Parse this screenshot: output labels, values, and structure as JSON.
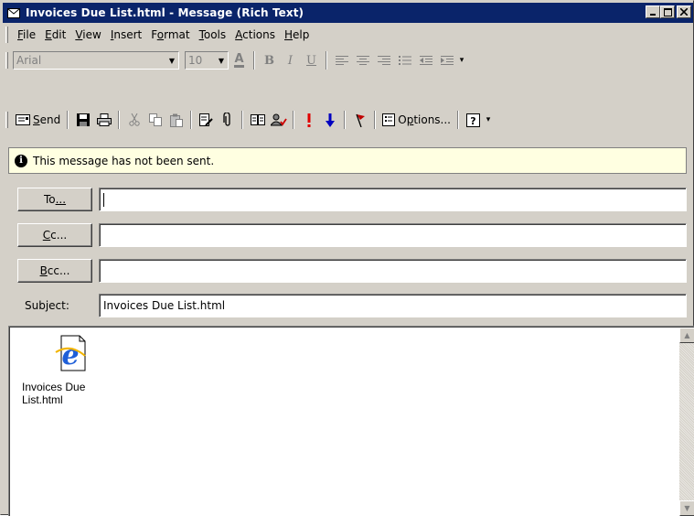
{
  "window": {
    "title": "Invoices Due List.html - Message (Rich Text)",
    "controls": [
      "_",
      "□",
      "×"
    ]
  },
  "menu": {
    "items": [
      {
        "pre": "",
        "ul": "F",
        "post": "ile"
      },
      {
        "pre": "",
        "ul": "E",
        "post": "dit"
      },
      {
        "pre": "",
        "ul": "V",
        "post": "iew"
      },
      {
        "pre": "",
        "ul": "I",
        "post": "nsert"
      },
      {
        "pre": "F",
        "ul": "o",
        "post": "rmat"
      },
      {
        "pre": "",
        "ul": "T",
        "post": "ools"
      },
      {
        "pre": "",
        "ul": "A",
        "post": "ctions"
      },
      {
        "pre": "",
        "ul": "H",
        "post": "elp"
      }
    ]
  },
  "format_toolbar": {
    "font": "Arial",
    "size": "10",
    "font_color_glyph": "A",
    "bold": "B",
    "italic": "I",
    "underline": "U"
  },
  "standard_toolbar": {
    "send_ul": "S",
    "send_rest": "end",
    "options_pre": "O",
    "options_ul": "p",
    "options_rest": "tions..."
  },
  "info_bar": {
    "icon": "i",
    "text": "This message has not been sent."
  },
  "addressing": {
    "to_button_pre": "To",
    "to_button_ul": "...",
    "cc_button_ul": "C",
    "cc_button_rest": "c...",
    "bcc_button_ul": "B",
    "bcc_button_rest": "cc...",
    "to_value": "",
    "cc_value": "",
    "bcc_value": "",
    "subject_label": "Subject:",
    "subject_value": "Invoices Due List.html"
  },
  "body": {
    "attachment_name": "Invoices Due List.html",
    "attachment_icon": "internet-explorer-document-icon"
  },
  "colors": {
    "titlebar": "#0a246a",
    "chrome": "#d4d0c8",
    "info_bg": "#ffffe1",
    "importance_high": "#e00000",
    "importance_low": "#0000c0"
  }
}
